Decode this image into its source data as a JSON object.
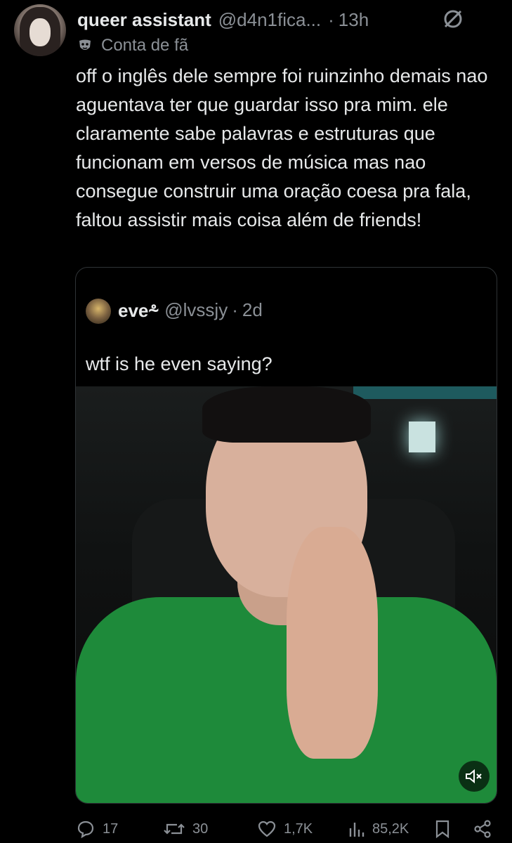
{
  "tweet": {
    "display_name": "queer assistant",
    "handle": "@d4n1fica...",
    "separator": "·",
    "time": "13h",
    "label": "Conta de fã",
    "text": "off o inglês dele sempre foi ruinzinho demais nao aguentava ter que guardar isso pra mim. ele claramente sabe palavras e estruturas que funcionam em versos de música mas nao consegue construir uma oração coesa pra fala, faltou assistir mais coisa além de friends!"
  },
  "quote": {
    "display_name": "eve⸛",
    "handle": "@lvssjy",
    "separator": "·",
    "time": "2d",
    "text": "wtf is he even saying?"
  },
  "actions": {
    "replies": "17",
    "retweets": "30",
    "likes": "1,7K",
    "views": "85,2K"
  },
  "colors": {
    "background": "#000000",
    "text": "#e7e9ea",
    "muted": "#8b9096",
    "border": "#2f3336"
  }
}
